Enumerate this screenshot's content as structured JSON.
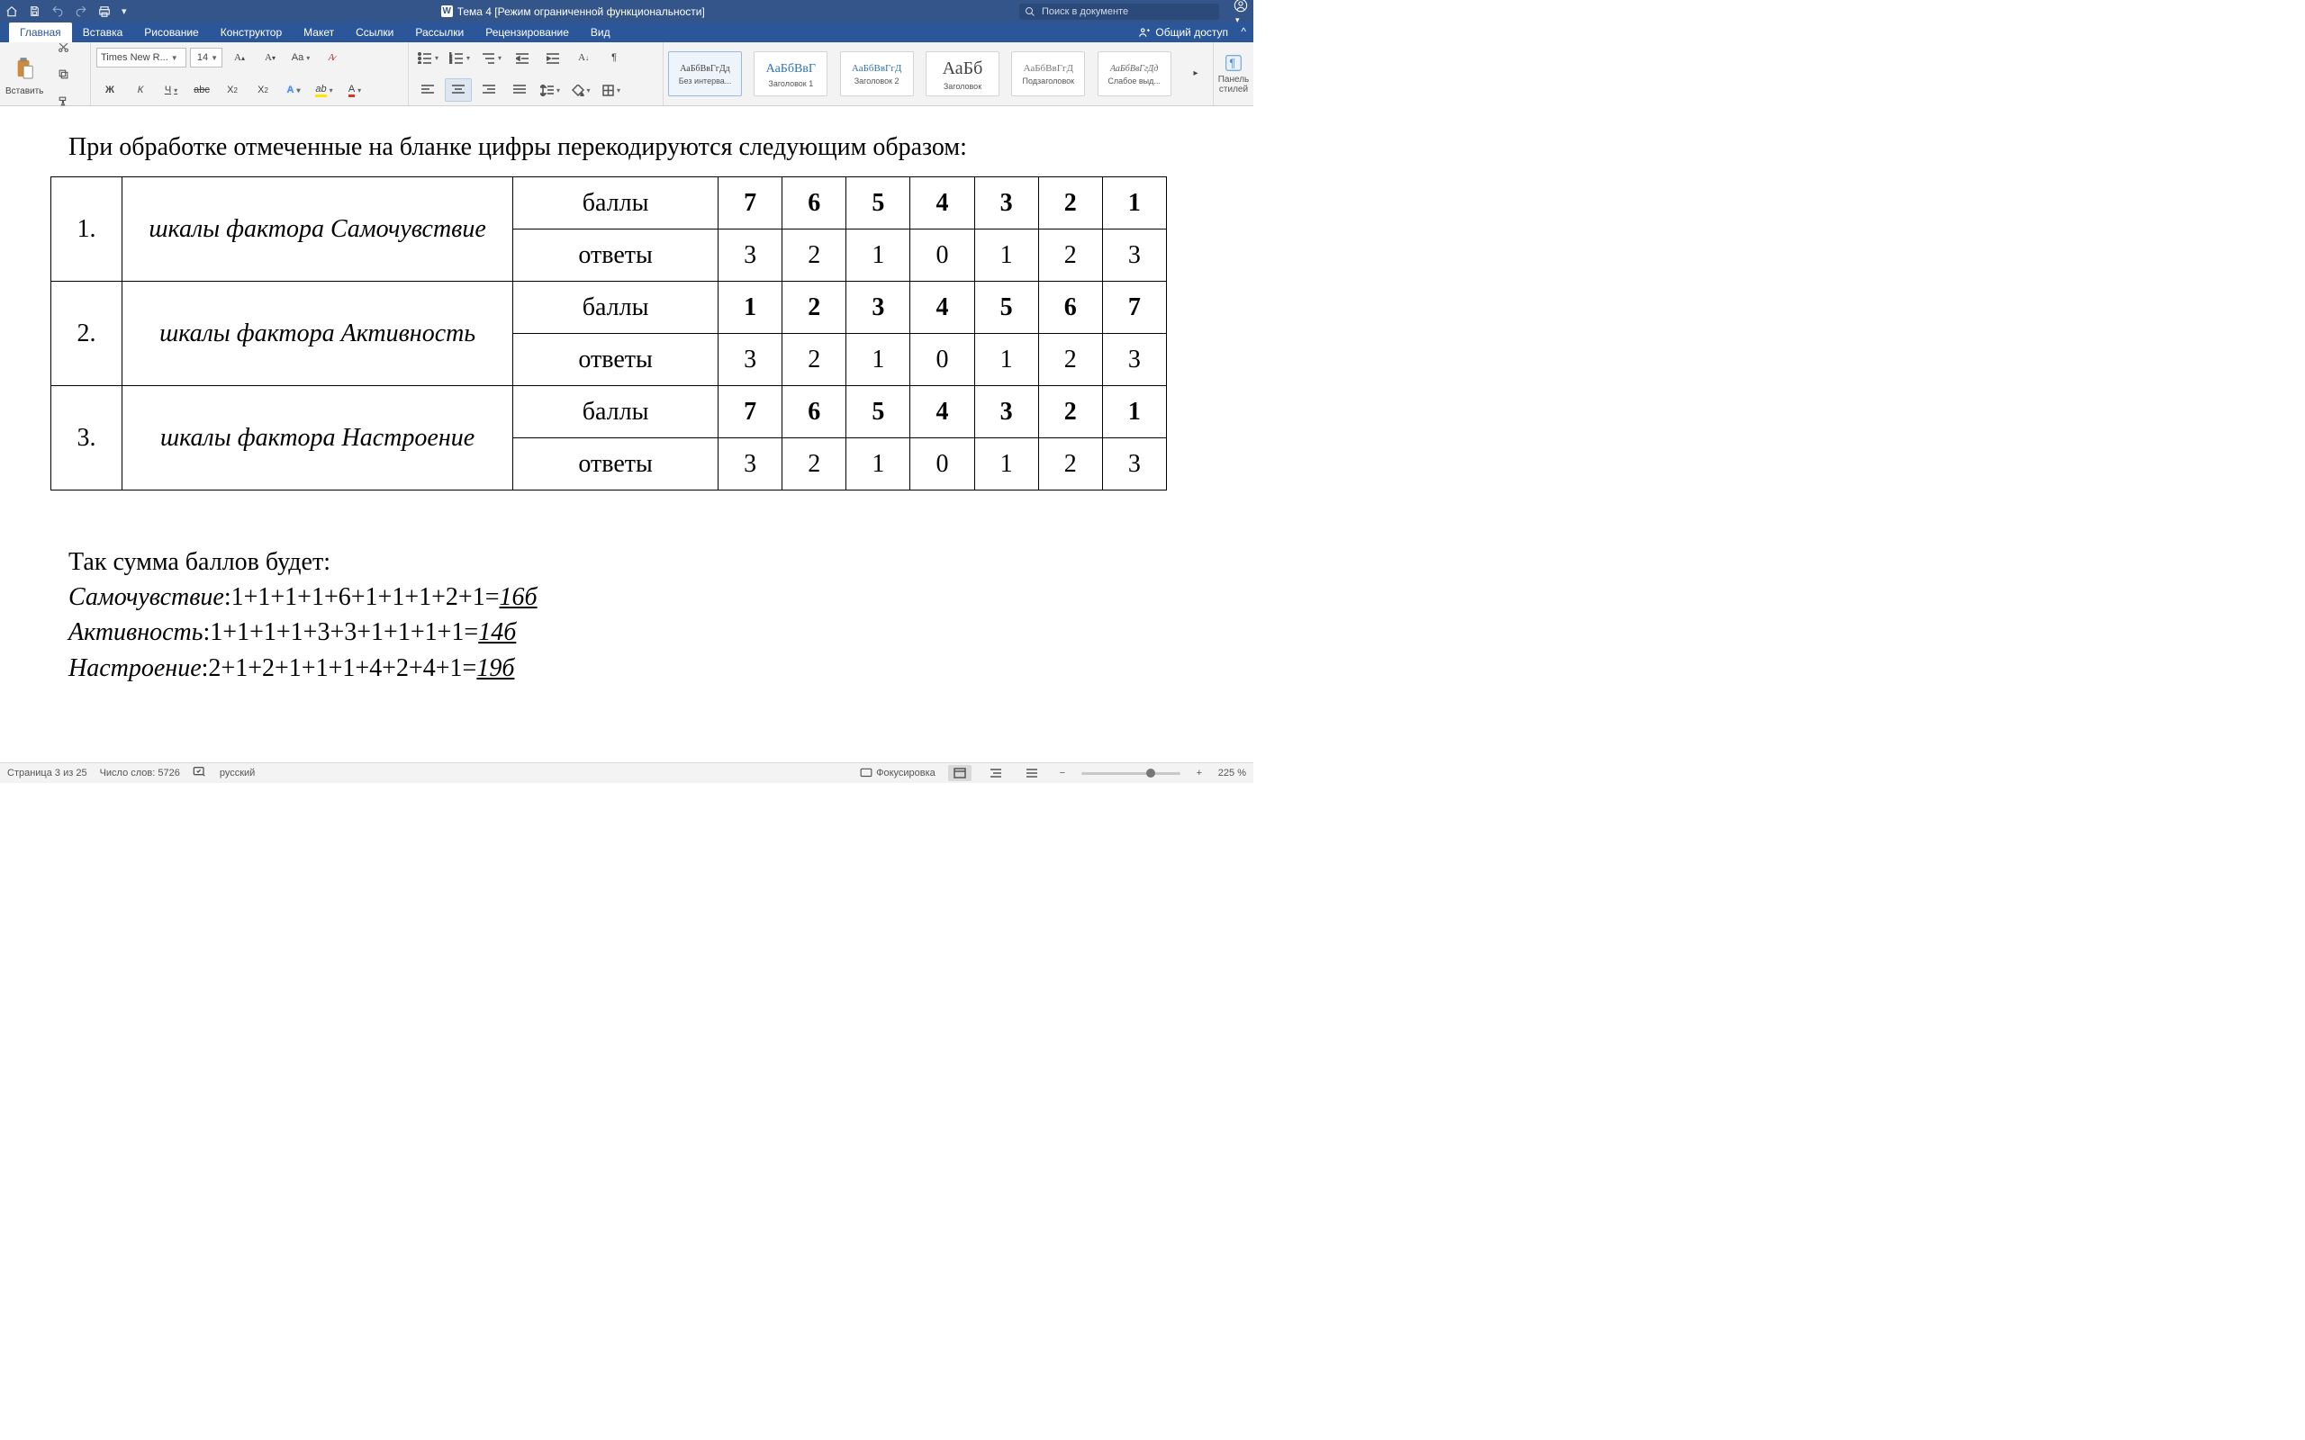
{
  "titlebar": {
    "doc_title": "Тема 4 [Режим ограниченной функциональности]",
    "search_placeholder": "Поиск в документе"
  },
  "tabs": {
    "items": [
      "Главная",
      "Вставка",
      "Рисование",
      "Конструктор",
      "Макет",
      "Ссылки",
      "Рассылки",
      "Рецензирование",
      "Вид"
    ],
    "active_index": 0,
    "share": "Общий доступ"
  },
  "ribbon": {
    "paste": "Вставить",
    "font_name": "Times New R...",
    "font_size": "14",
    "styles": [
      {
        "sample": "АаБбВвГгДд",
        "label": "Без интерва..."
      },
      {
        "sample": "АаБбВвГ",
        "label": "Заголовок 1"
      },
      {
        "sample": "АаБбВвГгД",
        "label": "Заголовок 2"
      },
      {
        "sample": "АаБб",
        "label": "Заголовок"
      },
      {
        "sample": "АаБбВвГгД",
        "label": "Подзаголовок"
      },
      {
        "sample": "АаБбВвГгДд",
        "label": "Слабое выд..."
      }
    ],
    "style_panel": "Панель\nстилей"
  },
  "doc": {
    "intro": "При обработке отмеченные на бланке цифры перекодируются следующим образом:",
    "rows": [
      {
        "n": "1.",
        "factor": "шкалы фактора Самочувствие",
        "scores": [
          "7",
          "6",
          "5",
          "4",
          "3",
          "2",
          "1"
        ],
        "answers": [
          "3",
          "2",
          "1",
          "0",
          "1",
          "2",
          "3"
        ]
      },
      {
        "n": "2.",
        "factor": "шкалы фактора Активность",
        "scores": [
          "1",
          "2",
          "3",
          "4",
          "5",
          "6",
          "7"
        ],
        "answers": [
          "3",
          "2",
          "1",
          "0",
          "1",
          "2",
          "3"
        ]
      },
      {
        "n": "3.",
        "factor": "шкалы фактора Настроение",
        "scores": [
          "7",
          "6",
          "5",
          "4",
          "3",
          "2",
          "1"
        ],
        "answers": [
          "3",
          "2",
          "1",
          "0",
          "1",
          "2",
          "3"
        ]
      }
    ],
    "label_scores": "баллы",
    "label_answers": "ответы",
    "sum_title": "Так сумма баллов будет:",
    "sums": [
      {
        "name": "Самочувствие",
        "expr": ":1+1+1+1+6+1+1+1+2+1=",
        "res": "16б"
      },
      {
        "name": "Активность",
        "expr": ":1+1+1+1+3+3+1+1+1+1=",
        "res": "14б"
      },
      {
        "name": "Настроение",
        "expr": ":2+1+2+1+1+1+4+2+4+1=",
        "res": "19б"
      }
    ]
  },
  "status": {
    "page": "Страница 3 из 25",
    "words": "Число слов: 5726",
    "lang": "русский",
    "focus": "Фокусировка",
    "zoom": "225 %"
  }
}
